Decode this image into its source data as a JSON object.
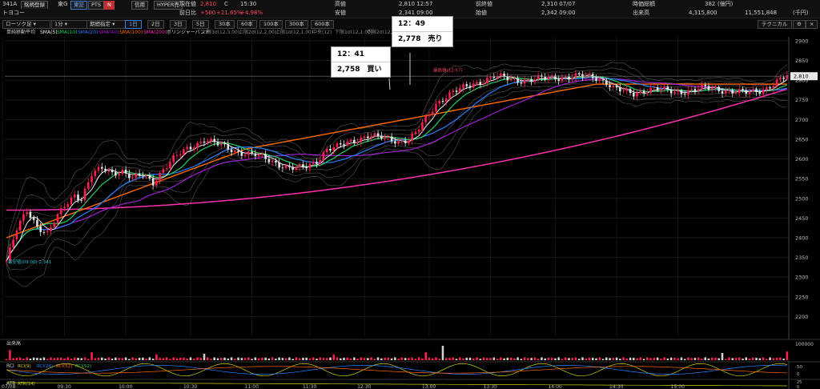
{
  "header": {
    "code": "341A",
    "btn_stock_search": "銘柄登録",
    "market": "東G",
    "name": "トヨコー",
    "btn_sor": "東証",
    "btn_pts": "PTS",
    "btn_news": "N",
    "btn_credit": "信用",
    "btn_hyper": "HYPER売",
    "cur_label": "現在値",
    "cur_value": "2,810",
    "cur_mark": "C",
    "cur_time": "15:30",
    "chg_label": "前日比",
    "chg_value": "+500",
    "chg_pct1": "+21.65%",
    "chg_pct2": "+4.98%",
    "high_label": "高値",
    "high_value": "2,810 12:57",
    "low_label": "安値",
    "low_value": "2,341 09:00",
    "prev_label": "前終値",
    "prev_value": "2,310 07/07",
    "open_label": "始値",
    "open_value": "2,342 09:00",
    "mcap_label": "時価総額",
    "mcap_value": "382",
    "mcap_unit": "(億円)",
    "vol_label": "出来高",
    "vol_value": "4,315,800",
    "amount_value": "11,551,848",
    "amount_unit": "(千円)"
  },
  "toolbar": {
    "chart_type": "ローソク足",
    "interval": "1分",
    "period_select": "期間指定",
    "tabs": [
      "1日",
      "2日",
      "3日",
      "5日",
      "30本",
      "60本",
      "100本",
      "300本",
      "600本"
    ],
    "active_tab": "1日",
    "technical": "テクニカル"
  },
  "legend": {
    "group": "単純移動平均",
    "items": [
      {
        "label": "SMA(5)",
        "color": "#e8e8e8"
      },
      {
        "label": "SMA(10)",
        "color": "#20d060"
      },
      {
        "label": "SMA(20)",
        "color": "#2a7fff"
      },
      {
        "label": "SMA(40)",
        "color": "#a020d0"
      },
      {
        "label": "SMA(100)",
        "color": "#ff6a00"
      },
      {
        "label": "SMA(200)",
        "color": "#ff2fb0"
      }
    ],
    "bb": "ボリンジャーバンド",
    "bb_items": [
      "上限3σ(12,3.00)",
      "上限2σ(12,2.00)",
      "上限1σ(12,1.00)",
      "中央(12)",
      "下限1σ(12,1.00)",
      "下限2σ(12,2.00)"
    ]
  },
  "annotations": {
    "buy_time": "12：41",
    "buy_price": "2,758　買い",
    "sell_time": "12：49",
    "sell_price": "2,778　売り",
    "high_marker": "最高値(12:57)",
    "low_marker": "最安値(09:00) 2,341"
  },
  "panels": {
    "volume_label": "出来高",
    "volume_max": "100000",
    "rci_label": "RCI",
    "rci_items": [
      "RCI(9)",
      "RCI(26)",
      "RCI(52)",
      "RCI(52)"
    ],
    "rci_ticks": [
      "50",
      "0"
    ],
    "atr_label": "ATR",
    "atr_item": "ATR(14)",
    "atr_ticks": [
      "25",
      "0"
    ]
  },
  "chart_data": {
    "type": "candlestick",
    "ylim": [
      2150,
      2910
    ],
    "yticks": [
      2200,
      2250,
      2300,
      2350,
      2400,
      2450,
      2500,
      2550,
      2600,
      2650,
      2700,
      2750,
      2800,
      2850,
      2900
    ],
    "current_price": 2810,
    "current_price_label": "2,810",
    "xticks": [
      "07/08",
      "09:30",
      "10:00",
      "10:30",
      "11:00",
      "11:30",
      "12:30",
      "13:00",
      "13:30",
      "14:00",
      "14:30",
      "15:00"
    ],
    "price_path": [
      [
        0,
        2341
      ],
      [
        3,
        2420
      ],
      [
        6,
        2470
      ],
      [
        9,
        2430
      ],
      [
        12,
        2410
      ],
      [
        14,
        2440
      ],
      [
        17,
        2480
      ],
      [
        20,
        2510
      ],
      [
        22,
        2500
      ],
      [
        25,
        2560
      ],
      [
        28,
        2575
      ],
      [
        31,
        2565
      ],
      [
        34,
        2570
      ],
      [
        37,
        2550
      ],
      [
        40,
        2560
      ],
      [
        43,
        2540
      ],
      [
        46,
        2575
      ],
      [
        49,
        2600
      ],
      [
        52,
        2620
      ],
      [
        55,
        2635
      ],
      [
        58,
        2650
      ],
      [
        61,
        2640
      ],
      [
        64,
        2630
      ],
      [
        67,
        2620
      ],
      [
        70,
        2615
      ],
      [
        73,
        2610
      ],
      [
        76,
        2600
      ],
      [
        79,
        2590
      ],
      [
        82,
        2580
      ],
      [
        85,
        2575
      ],
      [
        88,
        2580
      ],
      [
        91,
        2595
      ],
      [
        94,
        2625
      ],
      [
        97,
        2630
      ],
      [
        100,
        2640
      ],
      [
        103,
        2650
      ],
      [
        106,
        2660
      ],
      [
        109,
        2655
      ],
      [
        112,
        2650
      ],
      [
        115,
        2645
      ],
      [
        118,
        2650
      ],
      [
        120,
        2665
      ],
      [
        123,
        2700
      ],
      [
        126,
        2740
      ],
      [
        129,
        2760
      ],
      [
        131,
        2770
      ],
      [
        134,
        2780
      ],
      [
        137,
        2790
      ],
      [
        140,
        2800
      ],
      [
        143,
        2810
      ],
      [
        146,
        2805
      ],
      [
        149,
        2800
      ],
      [
        152,
        2800
      ],
      [
        155,
        2802
      ],
      [
        158,
        2804
      ],
      [
        161,
        2806
      ],
      [
        164,
        2808
      ],
      [
        167,
        2810
      ],
      [
        170,
        2808
      ],
      [
        173,
        2806
      ],
      [
        176,
        2795
      ],
      [
        178,
        2780
      ],
      [
        181,
        2770
      ],
      [
        184,
        2765
      ],
      [
        187,
        2775
      ],
      [
        190,
        2778
      ],
      [
        193,
        2774
      ],
      [
        196,
        2770
      ],
      [
        199,
        2772
      ],
      [
        202,
        2776
      ],
      [
        205,
        2780
      ],
      [
        208,
        2778
      ],
      [
        211,
        2774
      ],
      [
        214,
        2770
      ],
      [
        217,
        2768
      ],
      [
        220,
        2772
      ],
      [
        223,
        2780
      ],
      [
        226,
        2795
      ],
      [
        229,
        2810
      ]
    ],
    "volume_spikes": [
      [
        1,
        70
      ],
      [
        25,
        55
      ],
      [
        44,
        40
      ],
      [
        58,
        45
      ],
      [
        96,
        40
      ],
      [
        123,
        55
      ],
      [
        128,
        100
      ],
      [
        210,
        50
      ],
      [
        229,
        60
      ]
    ]
  }
}
